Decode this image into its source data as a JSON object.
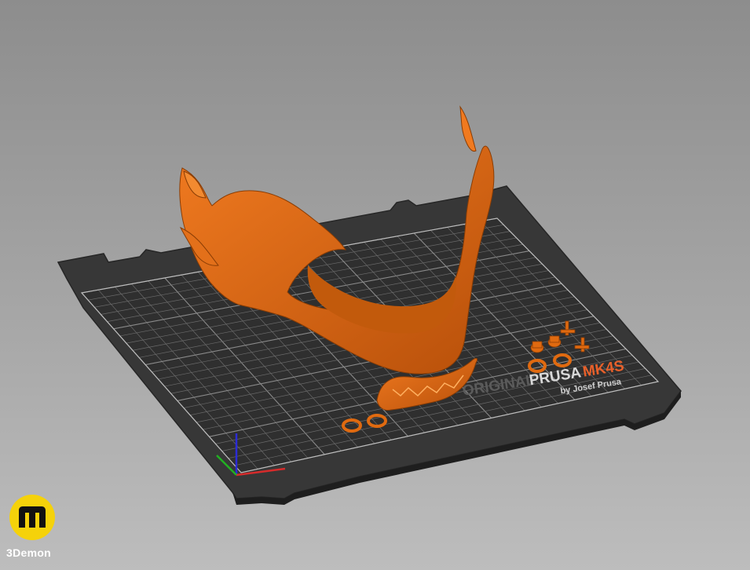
{
  "scene": {
    "bed_brand_line1_prefix": "ORIGINAL",
    "bed_brand_line1_name": "PRUSA",
    "bed_brand_line1_model": "MK4S",
    "bed_brand_line2": "by Josef Prusa",
    "model_color": "#e06a10",
    "bed_color": "#333333",
    "accent_color": "#e8602a"
  },
  "watermark": {
    "brand": "3Demon",
    "logo_color": "#f5d20a"
  }
}
